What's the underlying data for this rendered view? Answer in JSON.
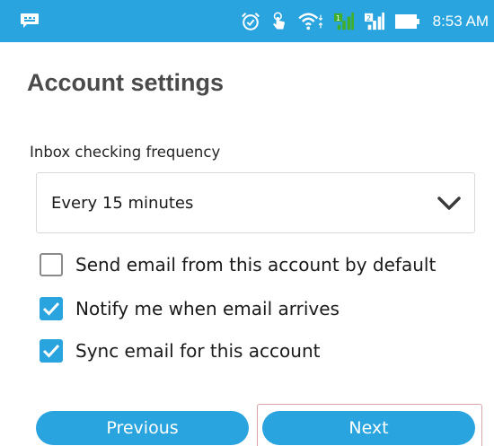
{
  "status_bar": {
    "time": "8:53 AM",
    "icons": [
      "chat-notification-icon",
      "alarm-icon",
      "touch-icon",
      "wifi-icon",
      "signal-sim1-icon",
      "signal-sim2-icon",
      "battery-icon"
    ],
    "sim2_badge": "2",
    "background_color": "#2aa4df"
  },
  "page": {
    "title": "Account settings"
  },
  "frequency": {
    "label": "Inbox checking frequency",
    "selected": "Every 15 minutes"
  },
  "options": [
    {
      "label": "Send email from this account by default",
      "checked": false
    },
    {
      "label": "Notify me when email arrives",
      "checked": true
    },
    {
      "label": "Sync email for this account",
      "checked": true
    }
  ],
  "buttons": {
    "previous_label": "Previous",
    "next_label": "Next"
  },
  "colors": {
    "accent": "#2aa4df",
    "title_text": "#4a4a4a",
    "focus_border": "#d7a5aa"
  }
}
